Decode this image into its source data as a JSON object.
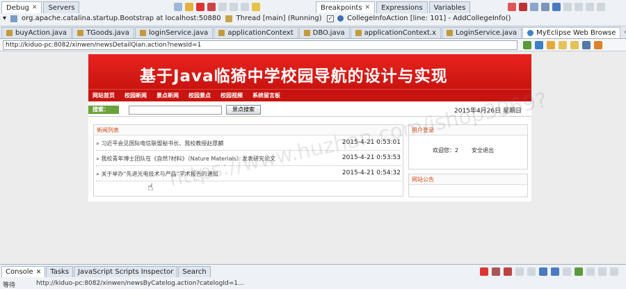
{
  "ide": {
    "debug_tabs": [
      {
        "label": "Debug",
        "active": true
      },
      {
        "label": "Servers",
        "active": false
      }
    ],
    "debug_crumb": {
      "process": "org.apache.catalina.startup.Bootstrap at localhost:50880",
      "thread": "Thread [main] (Running)"
    },
    "right_tabs": [
      {
        "label": "Breakpoints",
        "active": true
      },
      {
        "label": "Expressions",
        "active": false
      },
      {
        "label": "Variables",
        "active": false
      }
    ],
    "breakpoint_entry": "CollegeInfoAction [line: 101] - AddCollegeInfo()",
    "editor_tabs": [
      {
        "label": "buyAction.java",
        "active": false,
        "kind": "java"
      },
      {
        "label": "TGoods.java",
        "active": false,
        "kind": "java"
      },
      {
        "label": "loginService.java",
        "active": false,
        "kind": "java"
      },
      {
        "label": "applicationContext",
        "active": false,
        "kind": "java"
      },
      {
        "label": "DBO.java",
        "active": false,
        "kind": "java"
      },
      {
        "label": "applicationContext.x",
        "active": false,
        "kind": "java"
      },
      {
        "label": "LoginService.java",
        "active": false,
        "kind": "java"
      },
      {
        "label": "MyEclipse Web Browse",
        "active": true,
        "kind": "web"
      }
    ],
    "editor_more": "»4",
    "address_url": "http://kiduo-pc:8082/xinwen/newsDetailQian.action?newsId=1",
    "bottom_tabs": [
      {
        "label": "Console",
        "active": true
      },
      {
        "label": "Tasks",
        "active": false
      },
      {
        "label": "JavaScript Scripts Inspector",
        "active": false
      },
      {
        "label": "Search",
        "active": false
      }
    ],
    "status_prefix": "等待",
    "status_url": "http://kiduo-pc:8082/xinwen/newsByCatelog.action?catelogId=1..."
  },
  "site": {
    "title": "基于Java临猗中学校园导航的设计与实现",
    "nav": [
      "网站首页",
      "校园新闻",
      "景点新闻",
      "校园景点",
      "校园视频",
      "系统留言板"
    ],
    "search_label": "搜索：",
    "search_placeholder": "",
    "search_button": "景点搜索",
    "date": "2015年4月26日 星期日",
    "news_header": "新闻列表",
    "news": [
      {
        "title": "» 习近平会见国际电信联盟秘书长、我校教授赵厚麟",
        "time": "2015-4-21 0:53:01"
      },
      {
        "title": "» 我校青年博士团队在《自然?材料》（Nature Materials）发表研究论文",
        "time": "2015-4-21 0:53:53"
      },
      {
        "title": "» 关于举办“先进光电技术与产品”学术报告的通知",
        "time": "2015-4-21 0:54:32"
      }
    ],
    "login_header": "用户登录",
    "welcome": "欢迎您：2",
    "logout": "安全退出",
    "notice_header": "网站公告"
  },
  "watermark": "https://www.huzhan.com/ishop3069?",
  "colors": {
    "banner_red": "#d61a15",
    "nav_red": "#c81410",
    "search_green": "#6aa23b",
    "box_header_text": "#d24a14"
  }
}
